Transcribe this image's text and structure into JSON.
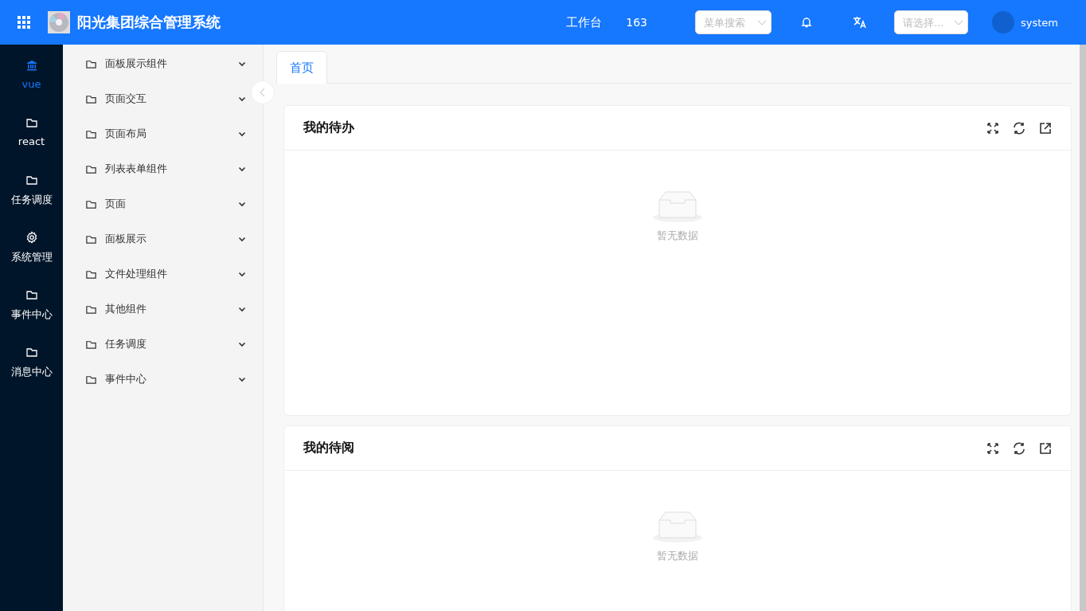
{
  "header": {
    "title": "阳光集团综合管理系统",
    "workbench": "工作台",
    "count": "163",
    "menu_search": {
      "placeholder": "菜单搜索"
    },
    "language_select": {
      "placeholder": "请选择..."
    },
    "user": "system"
  },
  "rail": [
    {
      "label": "vue",
      "kind": "bank",
      "selected": true
    },
    {
      "label": "react",
      "kind": "folder",
      "selected": false
    },
    {
      "label": "任务调度",
      "kind": "folder",
      "selected": false
    },
    {
      "label": "系统管理",
      "kind": "settings",
      "selected": false
    },
    {
      "label": "事件中心",
      "kind": "folder",
      "selected": false
    },
    {
      "label": "消息中心",
      "kind": "folder",
      "selected": false
    }
  ],
  "submenu": [
    {
      "label": "面板展示组件",
      "expanded": false
    },
    {
      "label": "页面交互",
      "expanded": false
    },
    {
      "label": "页面布局",
      "expanded": false
    },
    {
      "label": "列表表单组件",
      "expanded": false
    },
    {
      "label": "页面",
      "expanded": false
    },
    {
      "label": "面板展示",
      "expanded": false
    },
    {
      "label": "文件处理组件",
      "expanded": false
    },
    {
      "label": "其他组件",
      "expanded": false
    },
    {
      "label": "任务调度",
      "expanded": false
    },
    {
      "label": "事件中心",
      "expanded": false
    }
  ],
  "tabs": [
    {
      "label": "首页",
      "selected": true
    }
  ],
  "cards": [
    {
      "title": "我的待办",
      "empty_text": "暂无数据"
    },
    {
      "title": "我的待阅",
      "empty_text": "暂无数据"
    }
  ]
}
